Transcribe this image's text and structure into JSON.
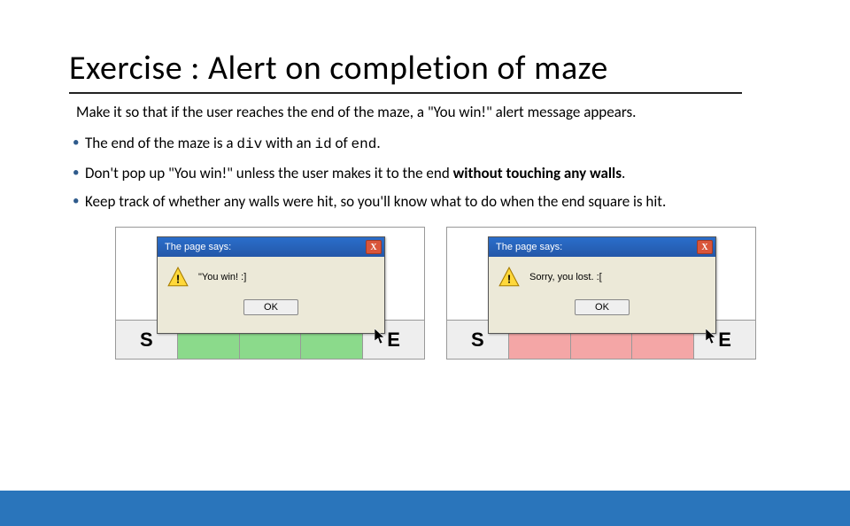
{
  "title": "Exercise : Alert on completion of maze",
  "lead": "Make it so that if the user reaches the end of the maze, a \"You win!\" alert message appears.",
  "bullets": {
    "b1_prefix": "The end of the maze is a ",
    "b1_code1": "div",
    "b1_mid": " with an ",
    "b1_code2": "id",
    "b1_mid2": " of ",
    "b1_code3": "end",
    "b1_suffix": ".",
    "b2_prefix": "Don't pop up \"You win!\" unless the user makes it to the end ",
    "b2_bold": "without touching any walls",
    "b2_suffix": ".",
    "b3": "Keep track of whether any walls were hit, so you'll know what to do when the end square is hit."
  },
  "alert_title": "The page says:",
  "alert_close": "X",
  "alert_ok": "OK",
  "msg_win": "\"You win! :]",
  "msg_lose": "Sorry, you lost. :[",
  "labels": {
    "S": "S",
    "E": "E"
  }
}
